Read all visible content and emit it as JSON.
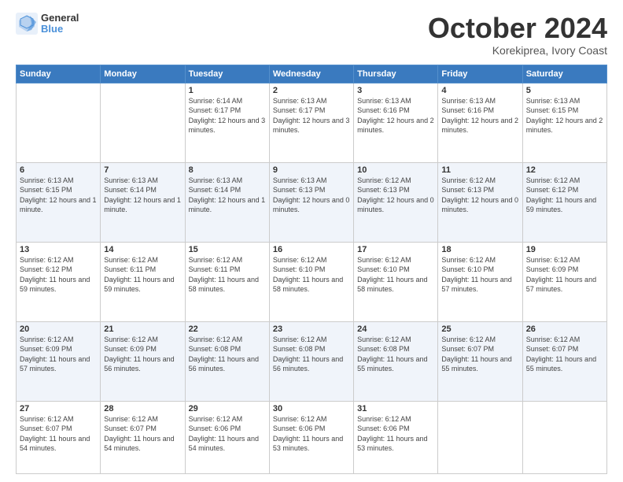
{
  "logo": {
    "text1": "General",
    "text2": "Blue"
  },
  "title": "October 2024",
  "location": "Korekiprea, Ivory Coast",
  "days_header": [
    "Sunday",
    "Monday",
    "Tuesday",
    "Wednesday",
    "Thursday",
    "Friday",
    "Saturday"
  ],
  "weeks": [
    [
      {
        "day": "",
        "info": ""
      },
      {
        "day": "",
        "info": ""
      },
      {
        "day": "1",
        "info": "Sunrise: 6:14 AM\nSunset: 6:17 PM\nDaylight: 12 hours and 3 minutes."
      },
      {
        "day": "2",
        "info": "Sunrise: 6:13 AM\nSunset: 6:17 PM\nDaylight: 12 hours and 3 minutes."
      },
      {
        "day": "3",
        "info": "Sunrise: 6:13 AM\nSunset: 6:16 PM\nDaylight: 12 hours and 2 minutes."
      },
      {
        "day": "4",
        "info": "Sunrise: 6:13 AM\nSunset: 6:16 PM\nDaylight: 12 hours and 2 minutes."
      },
      {
        "day": "5",
        "info": "Sunrise: 6:13 AM\nSunset: 6:15 PM\nDaylight: 12 hours and 2 minutes."
      }
    ],
    [
      {
        "day": "6",
        "info": "Sunrise: 6:13 AM\nSunset: 6:15 PM\nDaylight: 12 hours and 1 minute."
      },
      {
        "day": "7",
        "info": "Sunrise: 6:13 AM\nSunset: 6:14 PM\nDaylight: 12 hours and 1 minute."
      },
      {
        "day": "8",
        "info": "Sunrise: 6:13 AM\nSunset: 6:14 PM\nDaylight: 12 hours and 1 minute."
      },
      {
        "day": "9",
        "info": "Sunrise: 6:13 AM\nSunset: 6:13 PM\nDaylight: 12 hours and 0 minutes."
      },
      {
        "day": "10",
        "info": "Sunrise: 6:12 AM\nSunset: 6:13 PM\nDaylight: 12 hours and 0 minutes."
      },
      {
        "day": "11",
        "info": "Sunrise: 6:12 AM\nSunset: 6:13 PM\nDaylight: 12 hours and 0 minutes."
      },
      {
        "day": "12",
        "info": "Sunrise: 6:12 AM\nSunset: 6:12 PM\nDaylight: 11 hours and 59 minutes."
      }
    ],
    [
      {
        "day": "13",
        "info": "Sunrise: 6:12 AM\nSunset: 6:12 PM\nDaylight: 11 hours and 59 minutes."
      },
      {
        "day": "14",
        "info": "Sunrise: 6:12 AM\nSunset: 6:11 PM\nDaylight: 11 hours and 59 minutes."
      },
      {
        "day": "15",
        "info": "Sunrise: 6:12 AM\nSunset: 6:11 PM\nDaylight: 11 hours and 58 minutes."
      },
      {
        "day": "16",
        "info": "Sunrise: 6:12 AM\nSunset: 6:10 PM\nDaylight: 11 hours and 58 minutes."
      },
      {
        "day": "17",
        "info": "Sunrise: 6:12 AM\nSunset: 6:10 PM\nDaylight: 11 hours and 58 minutes."
      },
      {
        "day": "18",
        "info": "Sunrise: 6:12 AM\nSunset: 6:10 PM\nDaylight: 11 hours and 57 minutes."
      },
      {
        "day": "19",
        "info": "Sunrise: 6:12 AM\nSunset: 6:09 PM\nDaylight: 11 hours and 57 minutes."
      }
    ],
    [
      {
        "day": "20",
        "info": "Sunrise: 6:12 AM\nSunset: 6:09 PM\nDaylight: 11 hours and 57 minutes."
      },
      {
        "day": "21",
        "info": "Sunrise: 6:12 AM\nSunset: 6:09 PM\nDaylight: 11 hours and 56 minutes."
      },
      {
        "day": "22",
        "info": "Sunrise: 6:12 AM\nSunset: 6:08 PM\nDaylight: 11 hours and 56 minutes."
      },
      {
        "day": "23",
        "info": "Sunrise: 6:12 AM\nSunset: 6:08 PM\nDaylight: 11 hours and 56 minutes."
      },
      {
        "day": "24",
        "info": "Sunrise: 6:12 AM\nSunset: 6:08 PM\nDaylight: 11 hours and 55 minutes."
      },
      {
        "day": "25",
        "info": "Sunrise: 6:12 AM\nSunset: 6:07 PM\nDaylight: 11 hours and 55 minutes."
      },
      {
        "day": "26",
        "info": "Sunrise: 6:12 AM\nSunset: 6:07 PM\nDaylight: 11 hours and 55 minutes."
      }
    ],
    [
      {
        "day": "27",
        "info": "Sunrise: 6:12 AM\nSunset: 6:07 PM\nDaylight: 11 hours and 54 minutes."
      },
      {
        "day": "28",
        "info": "Sunrise: 6:12 AM\nSunset: 6:07 PM\nDaylight: 11 hours and 54 minutes."
      },
      {
        "day": "29",
        "info": "Sunrise: 6:12 AM\nSunset: 6:06 PM\nDaylight: 11 hours and 54 minutes."
      },
      {
        "day": "30",
        "info": "Sunrise: 6:12 AM\nSunset: 6:06 PM\nDaylight: 11 hours and 53 minutes."
      },
      {
        "day": "31",
        "info": "Sunrise: 6:12 AM\nSunset: 6:06 PM\nDaylight: 11 hours and 53 minutes."
      },
      {
        "day": "",
        "info": ""
      },
      {
        "day": "",
        "info": ""
      }
    ]
  ]
}
